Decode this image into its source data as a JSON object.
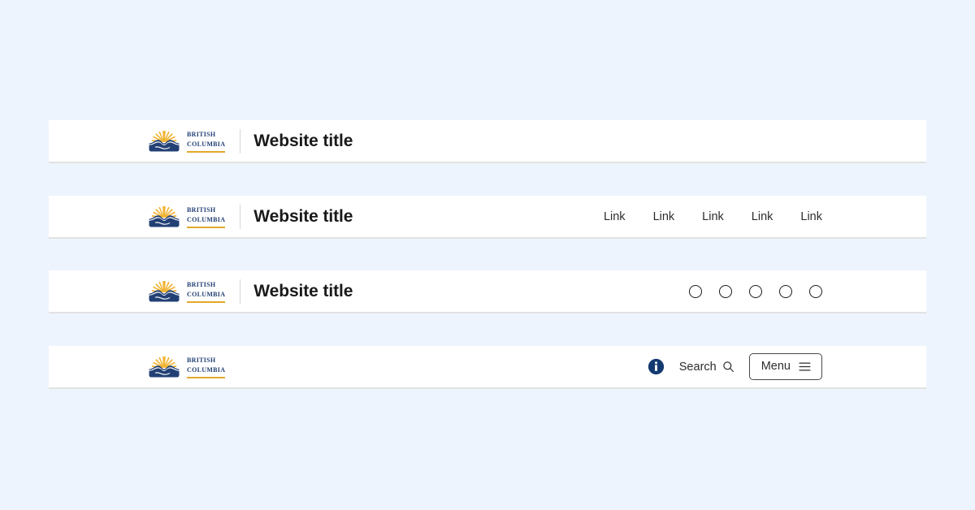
{
  "theme": {
    "page_background": "#edf4fd",
    "card_background": "#ffffff",
    "card_border": "#e2e2e2",
    "brand_navy": "#234075",
    "brand_gold": "#e3a82b",
    "text_primary": "#1a1a1a",
    "info_icon_fill": "#133a70"
  },
  "logo": {
    "name": "british-columbia-logo",
    "line1": "British",
    "line2": "Columbia",
    "alt": "Government of British Columbia"
  },
  "headers": [
    {
      "variant": "title-only",
      "site_title": "Website title"
    },
    {
      "variant": "title-with-links",
      "site_title": "Website title",
      "links": [
        {
          "label": "Link"
        },
        {
          "label": "Link"
        },
        {
          "label": "Link"
        },
        {
          "label": "Link"
        },
        {
          "label": "Link"
        }
      ]
    },
    {
      "variant": "title-with-icons",
      "site_title": "Website title",
      "icons": [
        {
          "name": "circle-placeholder-icon-1"
        },
        {
          "name": "circle-placeholder-icon-2"
        },
        {
          "name": "circle-placeholder-icon-3"
        },
        {
          "name": "circle-placeholder-icon-4"
        },
        {
          "name": "circle-placeholder-icon-5"
        }
      ]
    },
    {
      "variant": "logo-with-utilities",
      "info_icon_name": "info-icon",
      "search_label": "Search",
      "search_icon_name": "search-icon",
      "menu_label": "Menu",
      "menu_icon_name": "hamburger-icon"
    }
  ]
}
